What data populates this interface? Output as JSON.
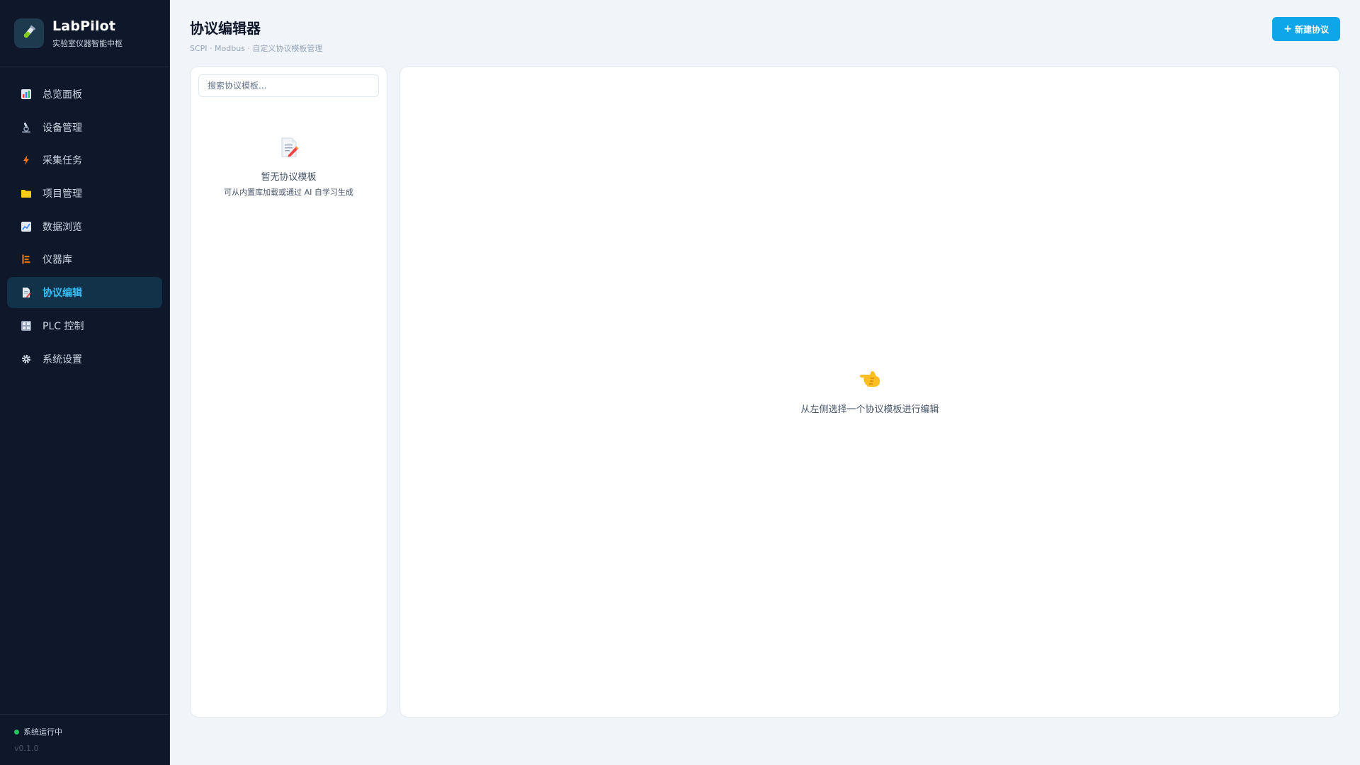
{
  "brand": {
    "name": "LabPilot",
    "subtitle": "实验室仪器智能中枢"
  },
  "nav": [
    {
      "label": "总览面板",
      "icon": "bar-chart-icon",
      "active": false
    },
    {
      "label": "设备管理",
      "icon": "microscope-icon",
      "active": false
    },
    {
      "label": "采集任务",
      "icon": "lightning-icon",
      "active": false
    },
    {
      "label": "项目管理",
      "icon": "folder-icon",
      "active": false
    },
    {
      "label": "数据浏览",
      "icon": "line-chart-icon",
      "active": false
    },
    {
      "label": "仪器库",
      "icon": "library-icon",
      "active": false
    },
    {
      "label": "协议编辑",
      "icon": "document-icon",
      "active": true
    },
    {
      "label": "PLC 控制",
      "icon": "grid-control-icon",
      "active": false
    },
    {
      "label": "系统设置",
      "icon": "gear-icon",
      "active": false
    }
  ],
  "footer": {
    "status": "系统运行中",
    "version": "v0.1.0"
  },
  "header": {
    "title": "协议编辑器",
    "breadcrumb": "SCPI · Modbus · 自定义协议模板管理",
    "new_button": "新建协议",
    "new_button_icon": "+"
  },
  "list": {
    "search_placeholder": "搜索协议模板...",
    "empty_title": "暂无协议模板",
    "empty_sub": "可从内置库加载或通过 AI 自学习生成"
  },
  "editor": {
    "hint": "从左侧选择一个协议模板进行编辑"
  },
  "colors": {
    "sidebar_bg": "#0f172a",
    "accent": "#0ea5e9",
    "active_text": "#38bdf8",
    "status_ok": "#22c55e"
  }
}
